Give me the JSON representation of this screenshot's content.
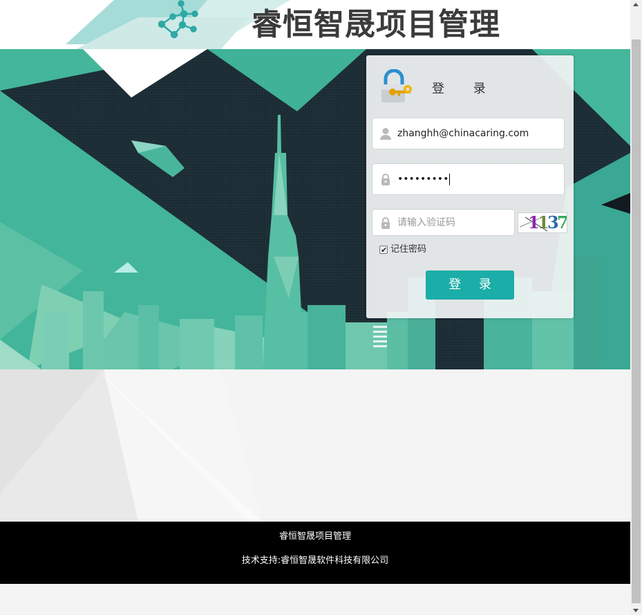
{
  "header": {
    "title": "睿恒智晟项目管理",
    "logo_icon": "network-nodes-icon"
  },
  "login": {
    "title": "登  录",
    "lock_icon": "lock-key-icon",
    "email": {
      "value": "zhanghh@chinacaring.com",
      "icon": "user-icon"
    },
    "password": {
      "masked_value": "•••••••••",
      "icon": "lock-icon"
    },
    "captcha": {
      "placeholder": "请输入验证码",
      "icon": "lock-icon",
      "code": "1137"
    },
    "remember": {
      "label": "记住密码",
      "checked": true
    },
    "submit_label": "登 录"
  },
  "footer": {
    "line1": "睿恒智晟项目管理",
    "line2": "技术支持:睿恒智晟软件科技有限公司"
  },
  "colors": {
    "accent": "#1bada7",
    "banner_teal": "#3fb59a",
    "banner_dark": "#1b2b33",
    "footer_bg": "#000000"
  }
}
